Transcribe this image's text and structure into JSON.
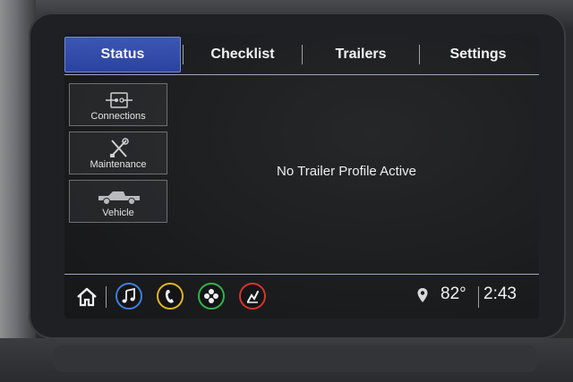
{
  "tabs": [
    {
      "label": "Status",
      "active": true
    },
    {
      "label": "Checklist",
      "active": false
    },
    {
      "label": "Trailers",
      "active": false
    },
    {
      "label": "Settings",
      "active": false
    }
  ],
  "side_menu": [
    {
      "label": "Connections",
      "icon": "connections-icon"
    },
    {
      "label": "Maintenance",
      "icon": "wrench-screwdriver-icon"
    },
    {
      "label": "Vehicle",
      "icon": "truck-icon"
    }
  ],
  "main": {
    "message": "No Trailer Profile Active"
  },
  "status_bar": {
    "apps": [
      {
        "name": "home-icon"
      },
      {
        "name": "music-icon",
        "color": "#3f7fd8"
      },
      {
        "name": "phone-icon",
        "color": "#e0b522"
      },
      {
        "name": "apps-grid-icon",
        "color": "#33b34a"
      },
      {
        "name": "climate-seat-icon",
        "color": "#d8342c"
      }
    ],
    "temperature": "82°",
    "time": "2:43"
  },
  "colors": {
    "accent_tab": "#2b43a0",
    "screen_bg": "#1a1b1d"
  }
}
